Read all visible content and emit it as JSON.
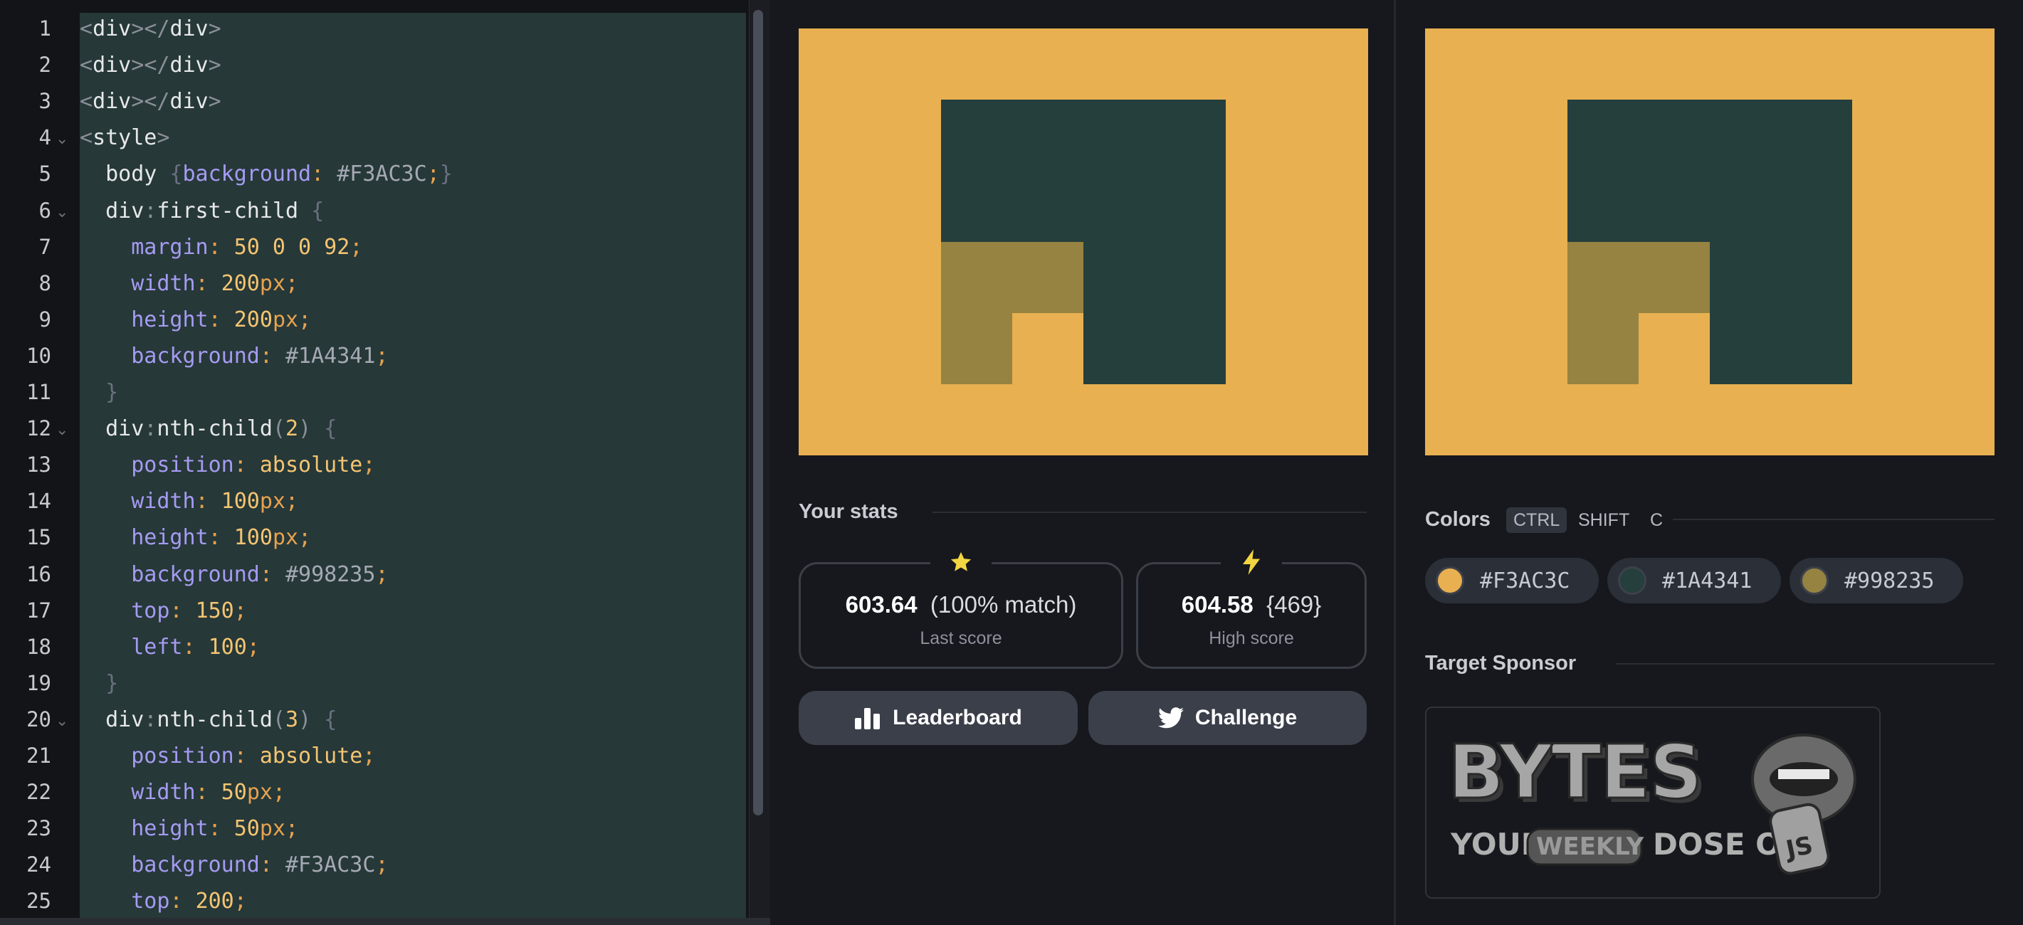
{
  "editor": {
    "lines": [
      {
        "n": "1"
      },
      {
        "n": "2"
      },
      {
        "n": "3"
      },
      {
        "n": "4",
        "fold": true
      },
      {
        "n": "5"
      },
      {
        "n": "6",
        "fold": true
      },
      {
        "n": "7"
      },
      {
        "n": "8"
      },
      {
        "n": "9"
      },
      {
        "n": "10"
      },
      {
        "n": "11"
      },
      {
        "n": "12",
        "fold": true
      },
      {
        "n": "13"
      },
      {
        "n": "14"
      },
      {
        "n": "15"
      },
      {
        "n": "16"
      },
      {
        "n": "17"
      },
      {
        "n": "18"
      },
      {
        "n": "19"
      },
      {
        "n": "20",
        "fold": true
      },
      {
        "n": "21"
      },
      {
        "n": "22"
      },
      {
        "n": "23"
      },
      {
        "n": "24"
      },
      {
        "n": "25"
      }
    ],
    "code": [
      "<div></div>",
      "<div></div>",
      "<div></div>",
      "<style>",
      "  body {background: #F3AC3C;}",
      "  div:first-child {",
      "    margin: 50 0 0 92;",
      "    width: 200px;",
      "    height: 200px;",
      "    background: #1A4341;",
      "  }",
      "  div:nth-child(2) {",
      "    position: absolute;",
      "    width: 100px;",
      "    height: 100px;",
      "    background: #998235;",
      "    top: 150;",
      "    left: 100;",
      "  }",
      "  div:nth-child(3) {",
      "    position: absolute;",
      "    width: 50px;",
      "    height: 50px;",
      "    background: #F3AC3C;",
      "    top: 200;"
    ]
  },
  "stats": {
    "title": "Your stats",
    "last_score_value": "603.64",
    "last_score_match": "(100% match)",
    "last_score_label": "Last score",
    "high_score_value": "604.58",
    "high_score_extra": "{469}",
    "high_score_label": "High score",
    "star_icon": "star-icon",
    "bolt_icon": "lightning-icon"
  },
  "buttons": {
    "leaderboard_label": "Leaderboard",
    "challenge_label": "Challenge"
  },
  "colors_section": {
    "title": "Colors",
    "shortcut_ctrl": "CTRL",
    "shortcut_shift": "SHIFT",
    "shortcut_c": "C",
    "swatches": [
      {
        "hex": "#F3AC3C",
        "color": "#F3AC3C"
      },
      {
        "hex": "#1A4341",
        "color": "#1A4341"
      },
      {
        "hex": "#998235",
        "color": "#998235"
      }
    ]
  },
  "sponsor": {
    "title": "Target Sponsor",
    "logo_word": "BYTES",
    "tagline_your": "YOUR",
    "tagline_weekly": "WEEKLY",
    "tagline_dose": "DOSE OF",
    "js_badge": "JS"
  },
  "palette": {
    "canvas_bg": "#e8b050",
    "dark_green": "#253f3d",
    "olive": "#968341",
    "accent_yellow": "#f2d542"
  }
}
